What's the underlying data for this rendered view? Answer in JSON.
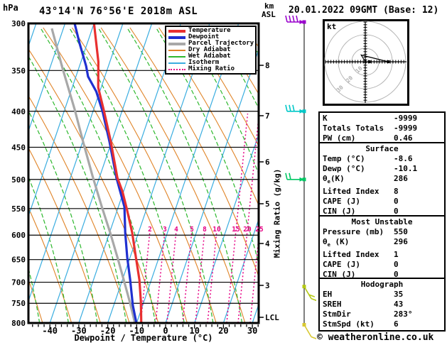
{
  "header": {
    "station_title": "43°14'N 76°56'E 2018m ASL",
    "datetime": "20.01.2022 09GMT (Base: 12)"
  },
  "chart_data": {
    "type": "skewt_log_p_sounding",
    "title": "43°14'N 76°56'E 2018m ASL",
    "datetime": "20.01.2022 09GMT (Base: 12)",
    "pressure_axis": {
      "unit": "hPa",
      "ticks": [
        300,
        350,
        400,
        450,
        500,
        550,
        600,
        650,
        700,
        750,
        800
      ]
    },
    "temperature_axis": {
      "label": "Dewpoint / Temperature (°C)",
      "ticks": [
        -40,
        -30,
        -20,
        -10,
        0,
        10,
        20,
        30
      ],
      "minor_step": 2
    },
    "altitude_axis": {
      "unit_line1": "km",
      "unit_line2": "ASL",
      "ticks_km": [
        8,
        7,
        6,
        5,
        4,
        3
      ],
      "lcl": "LCL"
    },
    "mixing_ratio_axis": {
      "label": "Mixing Ratio (g/kg)",
      "ticks": [
        2,
        3,
        4,
        5,
        8,
        10,
        15,
        20,
        25
      ]
    },
    "series": [
      {
        "name": "Temperature",
        "color": "#e83030",
        "width": 3.2,
        "points_p_t": [
          [
            300,
            -60
          ],
          [
            340,
            -54
          ],
          [
            370,
            -51
          ],
          [
            400,
            -46.2
          ],
          [
            440,
            -40.5
          ],
          [
            497,
            -33.8
          ],
          [
            520,
            -30.4
          ],
          [
            550,
            -26.9
          ],
          [
            595,
            -22.2
          ],
          [
            645,
            -18
          ],
          [
            695,
            -14.1
          ],
          [
            745,
            -11.1
          ],
          [
            800,
            -8.4
          ]
        ]
      },
      {
        "name": "Dewpoint",
        "color": "#2030d0",
        "width": 3.2,
        "points_p_t": [
          [
            300,
            -66.7
          ],
          [
            320,
            -62.7
          ],
          [
            345,
            -57.7
          ],
          [
            357,
            -55.8
          ],
          [
            375,
            -51.2
          ],
          [
            400,
            -46.7
          ],
          [
            442,
            -40.7
          ],
          [
            497,
            -34.1
          ],
          [
            547,
            -27.9
          ],
          [
            595,
            -24.6
          ],
          [
            645,
            -21
          ],
          [
            695,
            -17.3
          ],
          [
            755,
            -13.4
          ],
          [
            800,
            -10.1
          ]
        ]
      },
      {
        "name": "Parcel Trajectory",
        "color": "#a8a8a8",
        "width": 3.2,
        "points_p_t": [
          [
            305,
            -74
          ],
          [
            347,
            -65.7
          ],
          [
            398,
            -56.5
          ],
          [
            443,
            -49.7
          ],
          [
            494,
            -42.6
          ],
          [
            547,
            -35.7
          ],
          [
            595,
            -29.8
          ],
          [
            645,
            -24.4
          ],
          [
            695,
            -19.5
          ],
          [
            745,
            -15
          ],
          [
            800,
            -10.6
          ]
        ]
      }
    ],
    "wind_barbs": [
      {
        "pressure": 300,
        "color": "#9900cc",
        "speed_ticks": 4,
        "orientation": "left"
      },
      {
        "pressure": 400,
        "color": "#00c8c8",
        "speed_ticks": 3,
        "orientation": "left"
      },
      {
        "pressure": 500,
        "color": "#00c864",
        "speed_ticks": 2,
        "orientation": "left"
      },
      {
        "pressure": 710,
        "color": "#b4c814",
        "speed_ticks": 2,
        "orientation": "down-right"
      },
      {
        "pressure": 805,
        "color": "#d8c832",
        "speed_ticks": 1,
        "orientation": "down-right"
      }
    ],
    "background_line_colors": {
      "dry_adiabat": "#e08428",
      "wet_adiabat": "#2db82d",
      "isotherm": "#3aade0",
      "mixing_ratio": "#e60084"
    }
  },
  "legend": {
    "items": [
      {
        "label": "Temperature",
        "color": "#e83030",
        "style": "thick"
      },
      {
        "label": "Dewpoint",
        "color": "#2030d0",
        "style": "thick"
      },
      {
        "label": "Parcel Trajectory",
        "color": "#a8a8a8",
        "style": "thick"
      },
      {
        "label": "Dry Adiabat",
        "color": "#e08428",
        "style": "thin"
      },
      {
        "label": "Wet Adiabat",
        "color": "#2db82d",
        "style": "thin"
      },
      {
        "label": "Isotherm",
        "color": "#3aade0",
        "style": "thin"
      },
      {
        "label": "Mixing Ratio",
        "color": "#e60084",
        "style": "dotted"
      }
    ]
  },
  "hodograph": {
    "unit_label": "kt",
    "rings_kt": [
      10,
      20,
      30
    ],
    "trace_kt": [
      [
        0,
        0
      ],
      [
        -3,
        5
      ],
      [
        17,
        0
      ]
    ],
    "markers_kt": [
      [
        3,
        0
      ],
      [
        17,
        0
      ]
    ]
  },
  "info_panel": {
    "boxes": [
      {
        "title": "",
        "rows": [
          [
            "K",
            "-9999"
          ],
          [
            "Totals Totals",
            "-9999"
          ],
          [
            "PW (cm)",
            "0.46"
          ]
        ]
      },
      {
        "title": "Surface",
        "rows": [
          [
            "Temp (°C)",
            "-8.6"
          ],
          [
            "Dewp (°C)",
            "-10.1"
          ],
          [
            "θ_e(K)",
            "286"
          ],
          [
            "Lifted Index",
            "8"
          ],
          [
            "CAPE (J)",
            "0"
          ],
          [
            "CIN (J)",
            "0"
          ]
        ]
      },
      {
        "title": "Most Unstable",
        "rows": [
          [
            "Pressure (mb)",
            "550"
          ],
          [
            "θ_e (K)",
            "296"
          ],
          [
            "Lifted Index",
            "1"
          ],
          [
            "CAPE (J)",
            "0"
          ],
          [
            "CIN (J)",
            "0"
          ]
        ]
      },
      {
        "title": "Hodograph",
        "rows": [
          [
            "EH",
            "35"
          ],
          [
            "SREH",
            "43"
          ],
          [
            "StmDir",
            "283°"
          ],
          [
            "StmSpd (kt)",
            "6"
          ]
        ]
      }
    ]
  },
  "footer": {
    "copyright": "© weatheronline.co.uk"
  }
}
